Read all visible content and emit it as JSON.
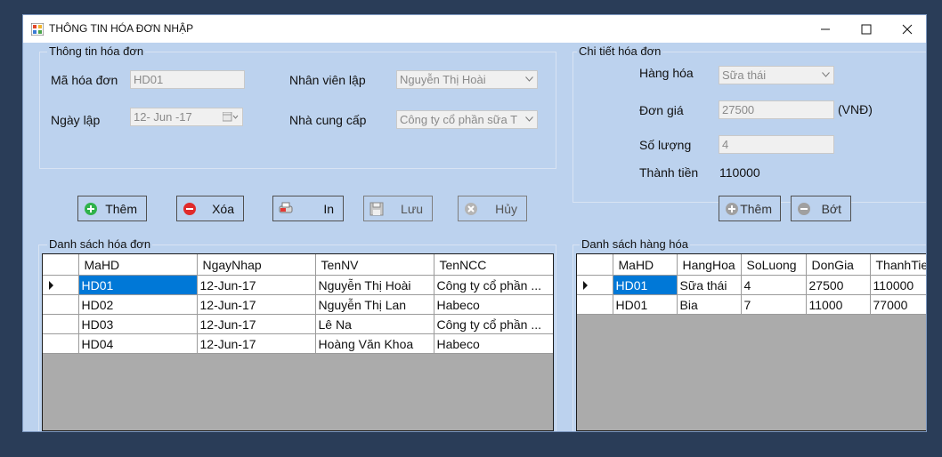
{
  "window": {
    "title": "THÔNG TIN HÓA ĐƠN NHẬP"
  },
  "invoice_info": {
    "group_title": "Thông tin hóa đơn",
    "ma_hoa_don_label": "Mã  hóa đơn",
    "ma_hoa_don_value": "HD01",
    "ngay_lap_label": "Ngày lập",
    "ngay_lap_value": "12- Jun -17",
    "nhan_vien_label": "Nhân viên lập",
    "nhan_vien_value": "Nguyễn Thị Hoài",
    "nha_cung_cap_label": "Nhà cung cấp",
    "nha_cung_cap_value": "Công ty cổ phần sữa TH"
  },
  "detail": {
    "group_title": "Chi tiết hóa đơn",
    "hang_hoa_label": "Hàng hóa",
    "hang_hoa_value": "Sữa thái",
    "don_gia_label": "Đơn giá",
    "don_gia_value": "27500",
    "currency": "(VNĐ)",
    "so_luong_label": "Số lượng",
    "so_luong_value": "4",
    "thanh_tien_label": "Thành tiền",
    "thanh_tien_value": "110000"
  },
  "buttons": {
    "them": "Thêm",
    "xoa": "Xóa",
    "in": "In",
    "luu": "Lưu",
    "huy": "Hủy",
    "them_detail": "Thêm",
    "bot": "Bớt"
  },
  "invoice_list": {
    "title": "Danh sách hóa đơn",
    "columns": [
      "MaHD",
      "NgayNhap",
      "TenNV",
      "TenNCC"
    ],
    "rows": [
      [
        "HD01",
        "12-Jun-17",
        "Nguyễn Thị Hoài",
        "Công ty cổ phần ..."
      ],
      [
        "HD02",
        "12-Jun-17",
        "Nguyễn Thị Lan",
        "Habeco"
      ],
      [
        "HD03",
        "12-Jun-17",
        "Lê Na",
        "Công ty cổ phần ..."
      ],
      [
        "HD04",
        "12-Jun-17",
        "Hoàng Văn Khoa",
        "Habeco"
      ]
    ]
  },
  "goods_list": {
    "title": "Danh sách hàng hóa",
    "columns": [
      "MaHD",
      "HangHoa",
      "SoLuong",
      "DonGia",
      "ThanhTie"
    ],
    "rows": [
      [
        "HD01",
        "Sữa thái",
        "4",
        "27500",
        "110000"
      ],
      [
        "HD01",
        "Bia",
        "7",
        "11000",
        "77000"
      ]
    ]
  },
  "colors": {
    "form_bg": "#bcd2ee",
    "desktop_bg": "#2a3d58",
    "selection": "#0078d7"
  }
}
